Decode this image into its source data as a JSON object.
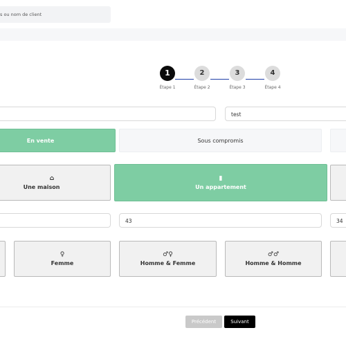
{
  "search": {
    "placeholder": "s ou nom de client"
  },
  "stepper": {
    "steps": [
      {
        "number": "1",
        "label": "Étape 1"
      },
      {
        "number": "2",
        "label": "Étape 2"
      },
      {
        "number": "3",
        "label": "Étape 3"
      },
      {
        "number": "4",
        "label": "Étape 4"
      }
    ],
    "active_step": 1
  },
  "form": {
    "field_left_value": "",
    "field_right_value": "test",
    "status_options": [
      "En vente",
      "Sous compromis",
      ""
    ],
    "status_selected": "En vente",
    "type_options": [
      {
        "label": "Une maison",
        "icon": "house-icon"
      },
      {
        "label": "Un appartement",
        "icon": "building-icon"
      }
    ],
    "type_selected": "Un appartement",
    "number_fields": [
      "",
      "43",
      "34"
    ],
    "occupant_options": [
      {
        "label": "Femme",
        "icon": "woman-icon"
      },
      {
        "label": "Homme & Femme",
        "icon": "man-woman-icon"
      },
      {
        "label": "Homme & Homme",
        "icon": "man-man-icon"
      }
    ]
  },
  "footer": {
    "prev_label": "Précédent",
    "next_label": "Suivant"
  },
  "colors": {
    "accent_green": "#7ecda3",
    "connector_blue": "#1f3fa8",
    "active_step": "#0b0b0b"
  }
}
